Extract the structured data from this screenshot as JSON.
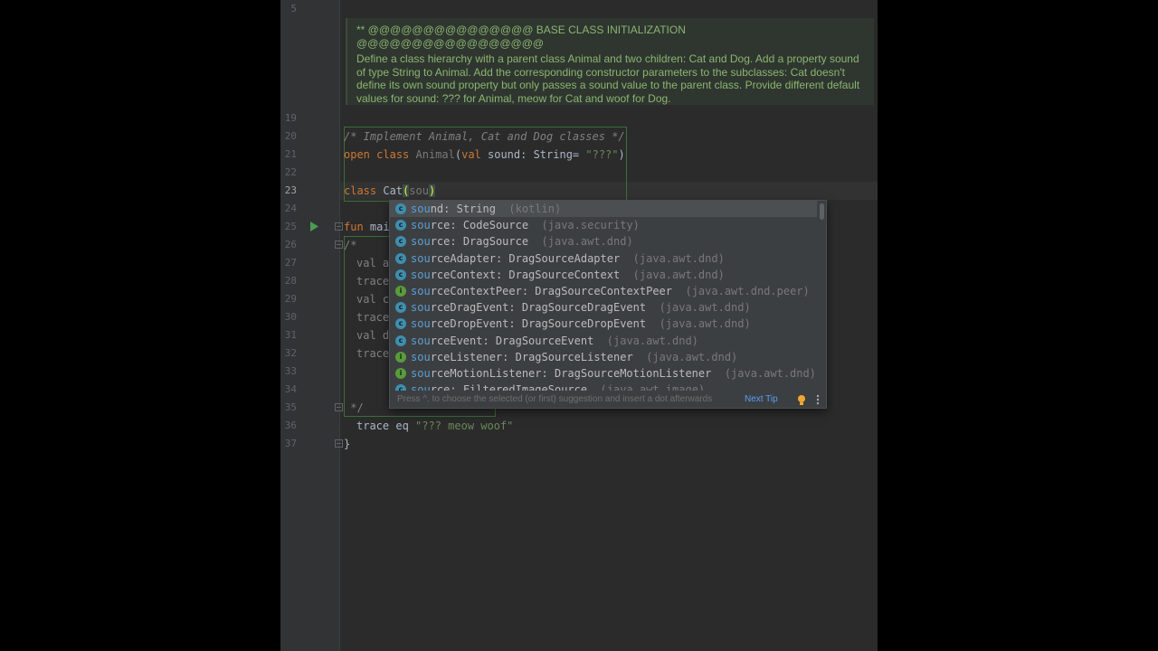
{
  "gutter": {
    "lines": [
      {
        "n": "5"
      },
      {
        "n": "19"
      },
      {
        "n": "20"
      },
      {
        "n": "21"
      },
      {
        "n": "22"
      },
      {
        "n": "23"
      },
      {
        "n": "24"
      },
      {
        "n": "25"
      },
      {
        "n": "26"
      },
      {
        "n": "27"
      },
      {
        "n": "28"
      },
      {
        "n": "29"
      },
      {
        "n": "30"
      },
      {
        "n": "31"
      },
      {
        "n": "32"
      },
      {
        "n": "33"
      },
      {
        "n": "34"
      },
      {
        "n": "35"
      },
      {
        "n": "36"
      },
      {
        "n": "37"
      }
    ],
    "run_icon": "run-triangle-icon"
  },
  "doc_comment": {
    "heading": "** @@@@@@@@@@@@@@@ BASE CLASS INITIALIZATION @@@@@@@@@@@@@@@@@",
    "body": "Define a class hierarchy with a parent class Animal and two children: Cat and Dog. Add a property sound of type String to Animal. Add the corresponding constructor parameters to the subclasses: Cat doesn't define its own sound property but only passes a sound value to the parent class. Provide different default values for sound: ??? for Animal, meow for Cat and woof for Dog."
  },
  "code": {
    "l20": "/* Implement Animal, Cat and Dog classes */",
    "l21_kw1": "open",
    "l21_kw2": "class",
    "l21_name": "Animal",
    "l21_p": "(",
    "l21_val": "val",
    "l21_param": " sound: String= ",
    "l21_str": "\"???\"",
    "l21_end": ")",
    "l23_kw": "class",
    "l23_name": " Cat",
    "l23_open": "(",
    "l23_typed": "sou",
    "l23_close": ")",
    "l25_kw": "fun",
    "l25_name": " mai",
    "l26": "/*",
    "l27": "val a",
    "l28": "trace",
    "l29": "val c",
    "l30": "trace",
    "l31": "val d",
    "l32": "trace",
    "l35": " */",
    "l36_a": "trace eq ",
    "l36_str": "\"??? meow woof\"",
    "l37": "}"
  },
  "completion": {
    "typed_prefix": "sou",
    "items": [
      {
        "icon": "c",
        "rest": "nd",
        "type": ": String",
        "pkg": "(kotlin)"
      },
      {
        "icon": "c",
        "rest": "rce",
        "type": ": CodeSource",
        "pkg": "(java.security)"
      },
      {
        "icon": "c",
        "rest": "rce",
        "type": ": DragSource",
        "pkg": "(java.awt.dnd)"
      },
      {
        "icon": "c",
        "rest": "rceAdapter",
        "type": ": DragSourceAdapter",
        "pkg": "(java.awt.dnd)"
      },
      {
        "icon": "c",
        "rest": "rceContext",
        "type": ": DragSourceContext",
        "pkg": "(java.awt.dnd)"
      },
      {
        "icon": "i",
        "rest": "rceContextPeer",
        "type": ": DragSourceContextPeer",
        "pkg": "(java.awt.dnd.peer)"
      },
      {
        "icon": "c",
        "rest": "rceDragEvent",
        "type": ": DragSourceDragEvent",
        "pkg": "(java.awt.dnd)"
      },
      {
        "icon": "c",
        "rest": "rceDropEvent",
        "type": ": DragSourceDropEvent",
        "pkg": "(java.awt.dnd)"
      },
      {
        "icon": "c",
        "rest": "rceEvent",
        "type": ": DragSourceEvent",
        "pkg": "(java.awt.dnd)"
      },
      {
        "icon": "i",
        "rest": "rceListener",
        "type": ": DragSourceListener",
        "pkg": "(java.awt.dnd)"
      },
      {
        "icon": "i",
        "rest": "rceMotionListener",
        "type": ": DragSourceMotionListener",
        "pkg": "(java.awt.dnd)"
      },
      {
        "icon": "c",
        "rest": "rce",
        "type": ": FilteredImageSource",
        "pkg": "(java.awt.image)"
      }
    ],
    "footer_hint": "Press ^. to choose the selected (or first) suggestion and insert a dot afterwards",
    "next_tip": "Next Tip"
  },
  "colors": {
    "editor_bg": "#2b2b2b",
    "keyword": "#cc7832",
    "string": "#6a8759",
    "doc_text": "#8bb56f",
    "link": "#589df6"
  }
}
